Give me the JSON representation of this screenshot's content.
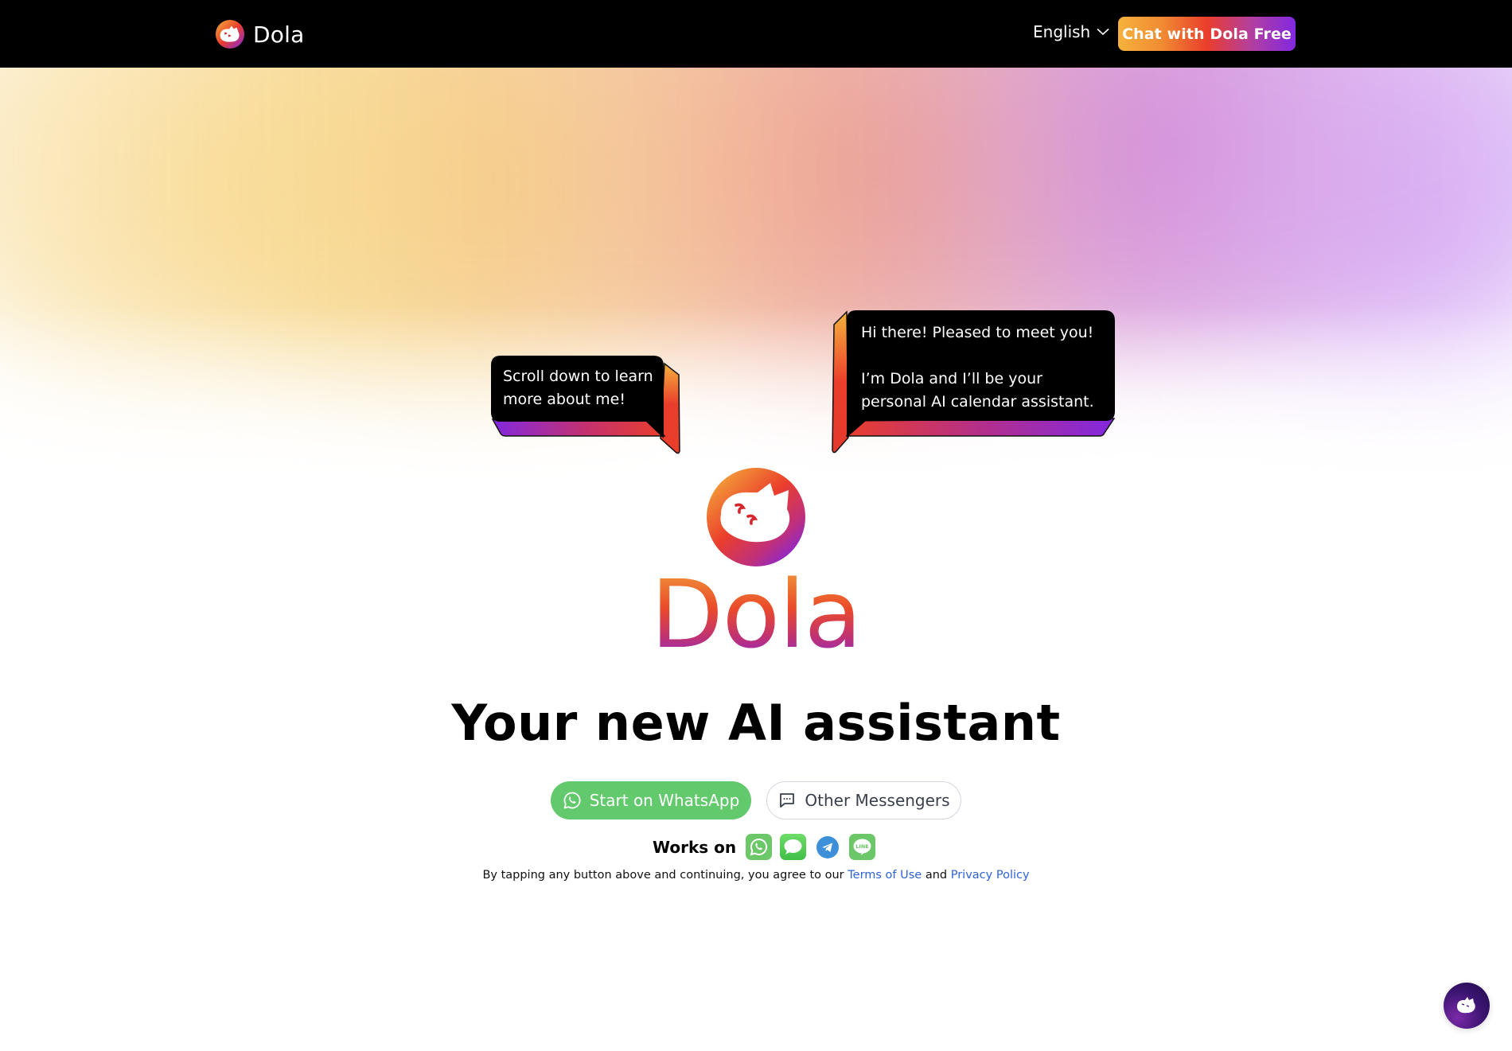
{
  "header": {
    "brand_name": "Dola",
    "language": "English",
    "cta_label": "Chat with Dola Free"
  },
  "bubbles": {
    "left": "Scroll down to learn\nmore about me!",
    "right": "Hi there! Pleased to meet you!\n\nI’m Dola and I’ll be your\npersonal AI calendar assistant."
  },
  "hero": {
    "wordmark": "Dola",
    "headline": "Your new AI assistant"
  },
  "actions": {
    "whatsapp_label": "Start on WhatsApp",
    "other_label": "Other Messengers"
  },
  "works_on": {
    "label": "Works on",
    "apps": [
      "whatsapp",
      "imessage",
      "telegram",
      "line"
    ]
  },
  "legal": {
    "prefix": "By tapping any button above and continuing, you agree to our ",
    "terms": "Terms of Use",
    "and": " and ",
    "privacy": "Privacy Policy"
  },
  "colors": {
    "accent_orange": "#f5b23c",
    "accent_red": "#ea3e2c",
    "accent_purple": "#8228e0",
    "whatsapp_green": "#62c96c",
    "link_blue": "#2f63d6"
  }
}
